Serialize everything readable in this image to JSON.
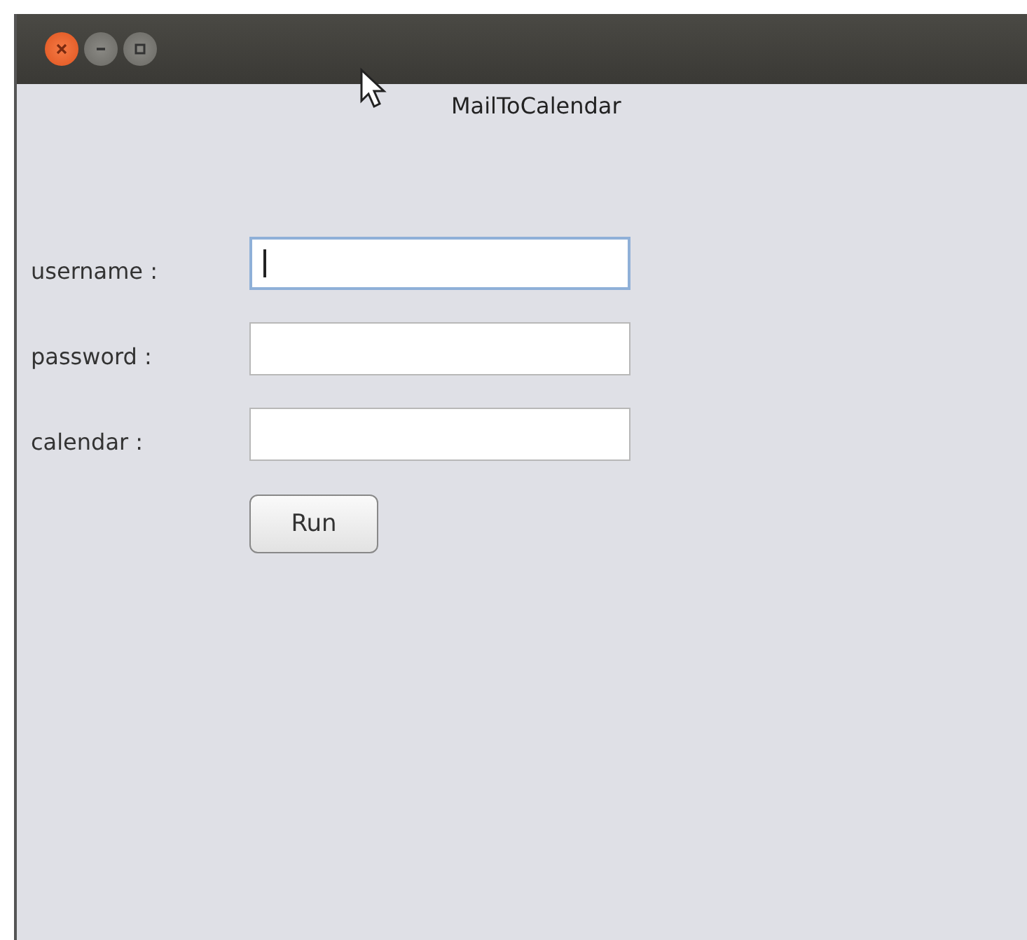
{
  "window": {
    "title": "MailToCalendar"
  },
  "fields": [
    {
      "label": "username :",
      "focused": true
    },
    {
      "label": "password :",
      "focused": false
    },
    {
      "label": "calendar :",
      "focused": false
    }
  ],
  "buttons": [
    "Run"
  ]
}
